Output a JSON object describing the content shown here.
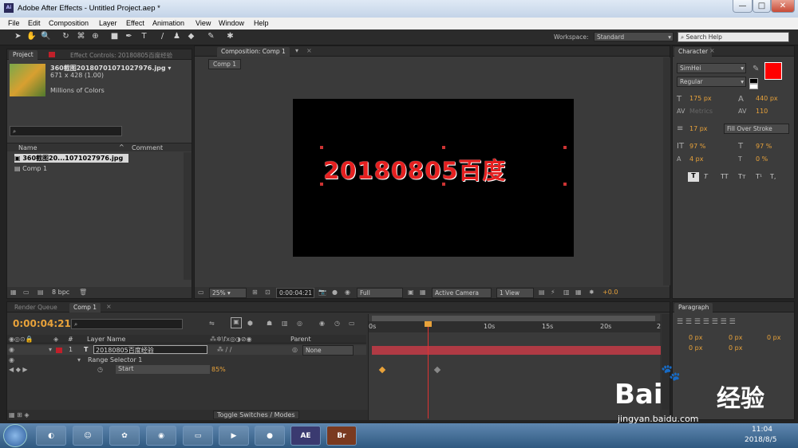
{
  "app": {
    "title": "Adobe After Effects - Untitled Project.aep *",
    "icon": "Ai"
  },
  "window_controls": {
    "minimize": "—",
    "maximize": "□",
    "close": "✕"
  },
  "menu": [
    "File",
    "Edit",
    "Composition",
    "Layer",
    "Effect",
    "Animation",
    "View",
    "Window",
    "Help"
  ],
  "toolbar": {
    "workspace_label": "Workspace:",
    "workspace_value": "Standard",
    "search_placeholder": "Search Help"
  },
  "project": {
    "tab": "Project",
    "effect_tab": "Effect Controls: 20180805百度经验",
    "thumb_name": "360截图20180701071027976.jpg ▾",
    "thumb_dims": "671 x 428 (1.00)",
    "thumb_colors": "Millions of Colors",
    "col_name": "Name",
    "col_comment": "Comment",
    "items": [
      "360截图20...1071027976.jpg",
      "Comp 1"
    ],
    "bpc": "8 bpc"
  },
  "composition": {
    "tab": "Composition: Comp 1",
    "subtab": "Comp 1",
    "text": "20180805百度",
    "zoom": "25%",
    "time": "0:00:04:21",
    "quality": "Full",
    "camera": "Active Camera",
    "view": "1 View",
    "offset": "+0.0"
  },
  "character": {
    "tab": "Character",
    "font": "SimHei",
    "style": "Regular",
    "size": "175 px",
    "leading": "440 px",
    "kerning": "Metrics",
    "tracking": "110",
    "stroke_w": "17 px",
    "stroke_mode": "Fill Over Stroke",
    "vscale": "97 %",
    "hscale": "97 %",
    "baseline": "4 px",
    "tsume": "0 %",
    "fill_color": "#ff0000",
    "styles": [
      "T",
      "T",
      "TT",
      "Tт",
      "T¹",
      "T,"
    ]
  },
  "paragraph": {
    "tab": "Paragraph",
    "values": [
      "0 px",
      "0 px",
      "0 px",
      "0 px",
      "0 px"
    ]
  },
  "timeline": {
    "render_tab": "Render Queue",
    "comp_tab": "Comp 1",
    "timecode": "0:00:04:21",
    "col_layer": "Layer Name",
    "col_parent": "Parent",
    "col_num": "#",
    "layer_num": "1",
    "layer_name": "20180805百度经验",
    "parent": "None",
    "range": "Range Selector 1",
    "start_label": "Start",
    "start_value": "85%",
    "ruler": [
      "0s",
      "10s",
      "15s",
      "20s",
      "2"
    ],
    "toggle": "Toggle Switches / Modes"
  },
  "taskbar": {
    "clock_time": "11:04",
    "clock_date": "2018/8/5",
    "apps": [
      "AE",
      "Br"
    ]
  },
  "watermark": {
    "brand": "Bai",
    "brand2": "经验",
    "url": "jingyan.baidu.com"
  }
}
